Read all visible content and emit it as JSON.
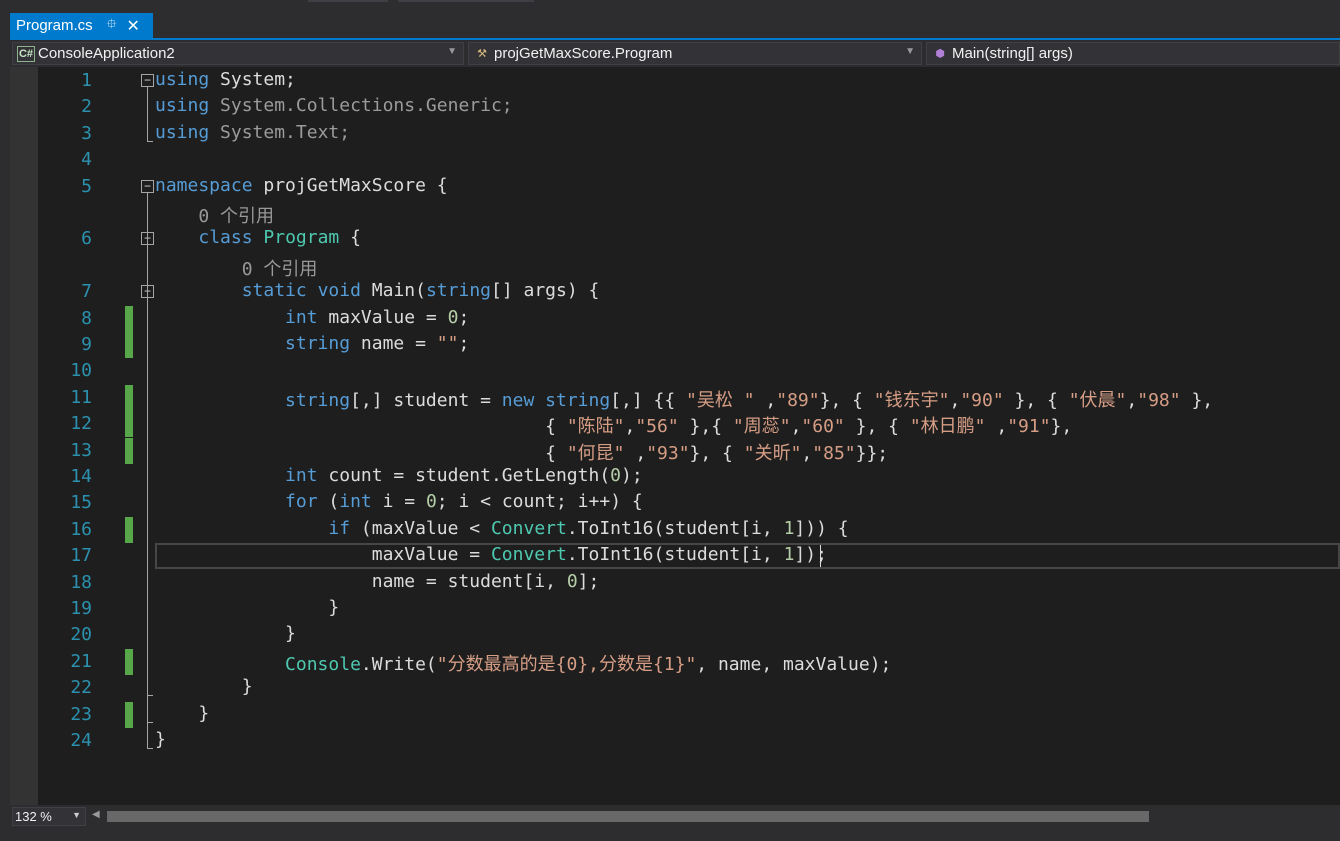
{
  "tab": {
    "label": "Program.cs",
    "pin_glyph": "pin-icon",
    "close_glyph": "close-icon"
  },
  "nav": {
    "project": "ConsoleApplication2",
    "type": "projGetMaxScore.Program",
    "member": "Main(string[] args)"
  },
  "editor": {
    "current_line": 17,
    "lines": [
      {
        "n": "1",
        "code": "<span class=\"kw\">using</span> System;"
      },
      {
        "n": "2",
        "code": "<span class=\"kw\">using</span> <span style=\"color:#9b9b9b\">System.Collections.Generic;</span>"
      },
      {
        "n": "3",
        "code": "<span class=\"kw\">using</span> <span style=\"color:#9b9b9b\">System.Text;</span>"
      },
      {
        "n": "4",
        "code": ""
      },
      {
        "n": "5",
        "code": "<span class=\"kw\">namespace</span> projGetMaxScore {"
      },
      {
        "lens": "    0 个引用"
      },
      {
        "n": "6",
        "code": "    <span class=\"kw\">class</span> <span class=\"ty\">Program</span> {"
      },
      {
        "lens": "        0 个引用"
      },
      {
        "n": "7",
        "code": "        <span class=\"kw\">static</span> <span class=\"kw\">void</span> Main(<span class=\"kw\">string</span>[] args) {"
      },
      {
        "n": "8",
        "code": "            <span class=\"kw\">int</span> maxValue = <span class=\"nm\">0</span>;"
      },
      {
        "n": "9",
        "code": "            <span class=\"kw\">string</span> name = <span class=\"st\">\"\"</span>;"
      },
      {
        "n": "10",
        "code": ""
      },
      {
        "n": "11",
        "code": "            <span class=\"kw\">string</span>[,] student = <span class=\"kw\">new</span> <span class=\"kw\">string</span>[,] {{ <span class=\"st\">\"吴松 \"</span> ,<span class=\"st\">\"89\"</span>}, { <span class=\"st\">\"钱东宇\"</span>,<span class=\"st\">\"90\"</span> }, { <span class=\"st\">\"伏晨\"</span>,<span class=\"st\">\"98\"</span> },"
      },
      {
        "n": "12",
        "code": "                                    { <span class=\"st\">\"陈陆\"</span>,<span class=\"st\">\"56\"</span> },{ <span class=\"st\">\"周蕊\"</span>,<span class=\"st\">\"60\"</span> }, { <span class=\"st\">\"林日鹏\"</span> ,<span class=\"st\">\"91\"</span>},"
      },
      {
        "n": "13",
        "code": "                                    { <span class=\"st\">\"何昆\"</span> ,<span class=\"st\">\"93\"</span>}, { <span class=\"st\">\"关昕\"</span>,<span class=\"st\">\"85\"</span>}};"
      },
      {
        "n": "14",
        "code": "            <span class=\"kw\">int</span> count = student.GetLength(<span class=\"nm\">0</span>);"
      },
      {
        "n": "15",
        "code": "            <span class=\"kw\">for</span> (<span class=\"kw\">int</span> i = <span class=\"nm\">0</span>; i &lt; count; i++) {"
      },
      {
        "n": "16",
        "code": "                <span class=\"kw\">if</span> (maxValue &lt; <span class=\"ty\">Convert</span>.ToInt16(student[i, <span class=\"nm\">1</span>])) {"
      },
      {
        "n": "17",
        "code": "                    maxValue = <span class=\"ty\">Convert</span>.ToInt16(student[i, <span class=\"nm\">1</span>]);"
      },
      {
        "n": "18",
        "code": "                    name = student[i, <span class=\"nm\">0</span>];"
      },
      {
        "n": "19",
        "code": "                }"
      },
      {
        "n": "20",
        "code": "            }"
      },
      {
        "n": "21",
        "code": "            <span class=\"ty\">Console</span>.Write(<span class=\"st\">\"分数最高的是{0},分数是{1}\"</span>, name, maxValue);"
      },
      {
        "n": "22",
        "code": "        }"
      },
      {
        "n": "23",
        "code": "    }"
      },
      {
        "n": "24",
        "code": "}"
      }
    ],
    "changed_lines": [
      "8",
      "9",
      "11",
      "12",
      "13",
      "16",
      "21",
      "23"
    ],
    "fold_lines": [
      "1",
      "5",
      "6",
      "7"
    ]
  },
  "status": {
    "zoom": "132 %"
  },
  "colors": {
    "accent": "#007acc",
    "keyword": "#569cd6",
    "type": "#4ec9b0",
    "string": "#d69d85",
    "number": "#b5cea8",
    "line_number": "#2b91af",
    "change_marker": "#57a64a"
  }
}
